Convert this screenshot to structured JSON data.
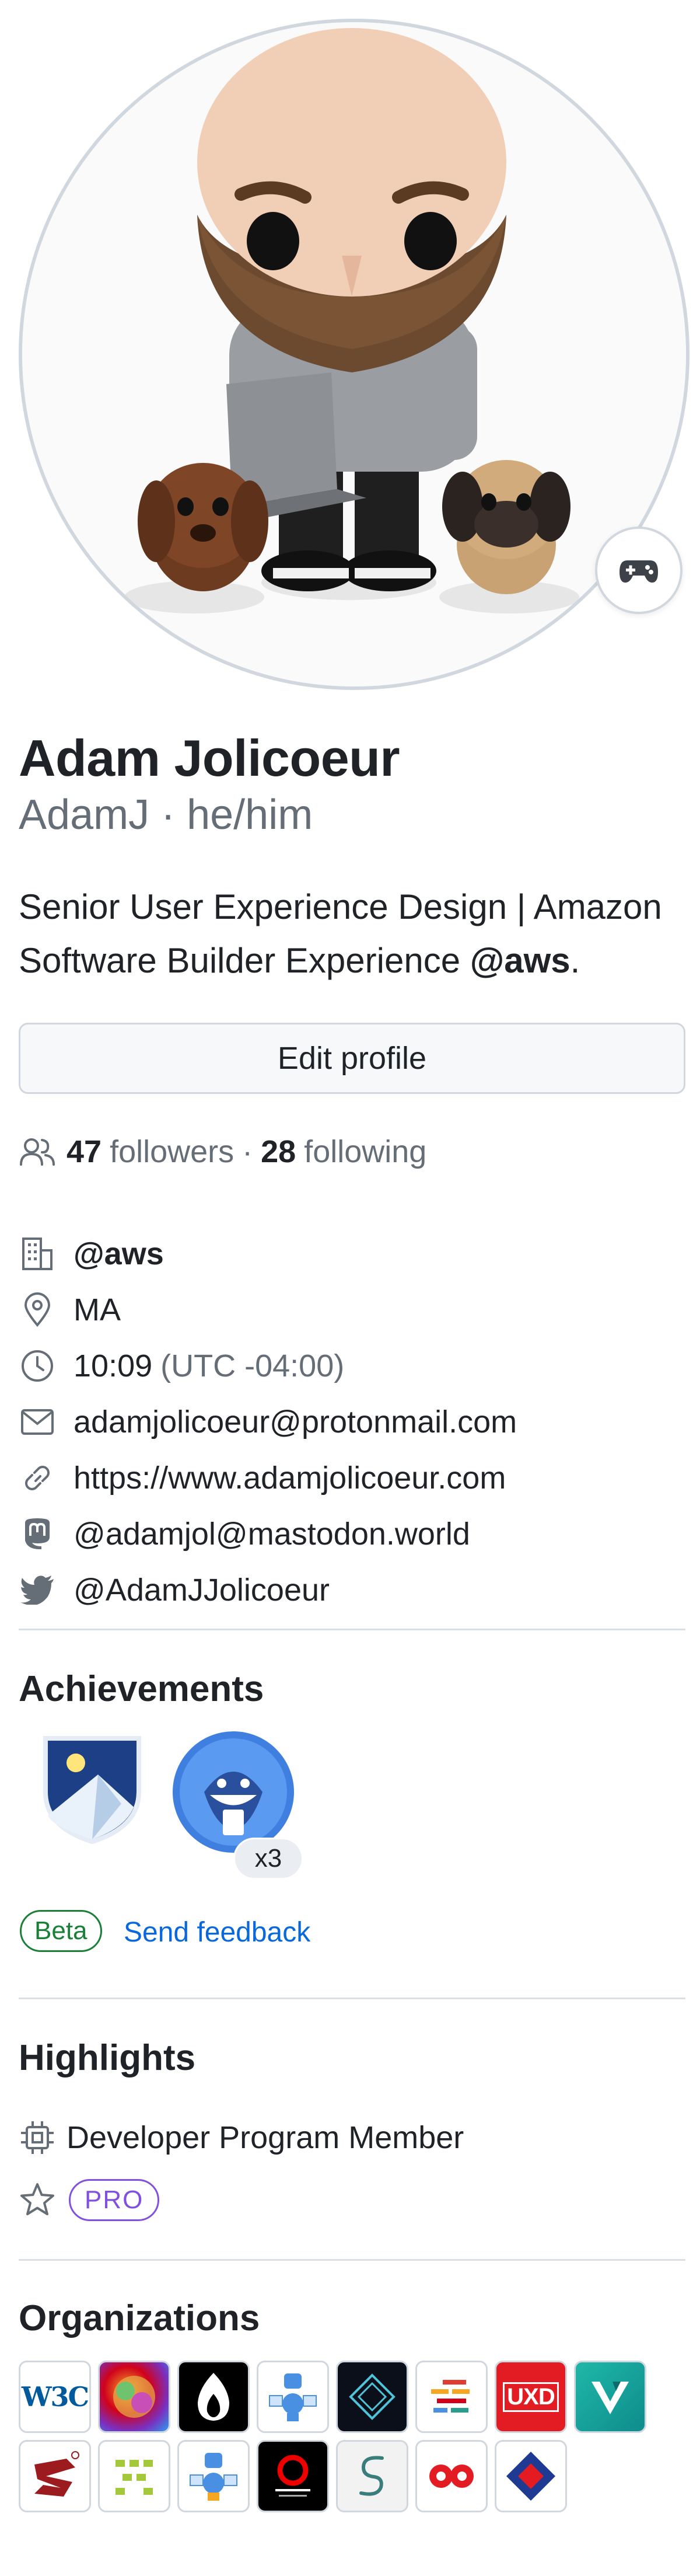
{
  "profile": {
    "name": "Adam Jolicoeur",
    "login_pronouns": "AdamJ · he/him",
    "bio_line1": "Senior User Experience Design | Amazon",
    "bio_line2_prefix": "Software Builder Experience ",
    "bio_handle": "@aws",
    "bio_suffix": ".",
    "edit_button": "Edit profile",
    "status_icon": "gamepad-icon"
  },
  "follow": {
    "followers_count": "47",
    "followers_label": "followers",
    "separator": "·",
    "following_count": "28",
    "following_label": "following"
  },
  "details": {
    "company": "@aws",
    "location": "MA",
    "time": "10:09",
    "timezone": "(UTC -04:00)",
    "email": "adamjolicoeur@protonmail.com",
    "website": "https://www.adamjolicoeur.com",
    "mastodon": "@adamjol@mastodon.world",
    "twitter": "@AdamJJolicoeur"
  },
  "achievements": {
    "title": "Achievements",
    "badges": [
      {
        "icon": "shield-mountain-badge-icon"
      },
      {
        "icon": "shark-badge-icon",
        "multiplier": "x3"
      }
    ],
    "beta_label": "Beta",
    "feedback_label": "Send feedback"
  },
  "highlights": {
    "title": "Highlights",
    "program": "Developer Program Member",
    "pro_label": "PRO"
  },
  "organizations": {
    "title": "Organizations",
    "w3c_label": "W3C",
    "uxd_label": "UXD"
  },
  "colors": {
    "text": "#1f2328",
    "muted": "#656d76",
    "link": "#0969da",
    "beta_green": "#1a7f37",
    "pro_purple": "#8250df",
    "border": "#d0d7de"
  }
}
